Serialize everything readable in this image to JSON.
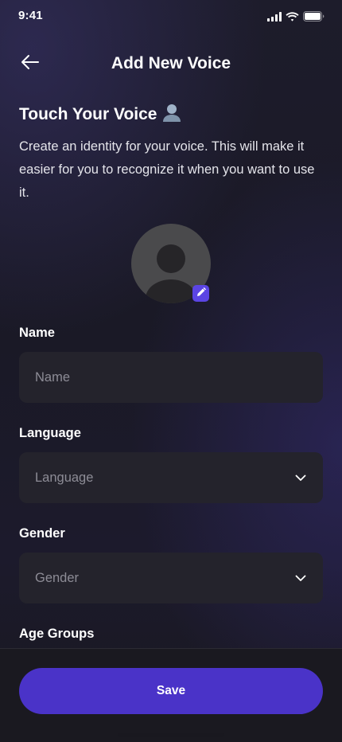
{
  "status_bar": {
    "time": "9:41",
    "signal_icon": "cellular-signal-icon",
    "wifi_icon": "wifi-icon",
    "battery_icon": "battery-icon"
  },
  "header": {
    "title": "Add New Voice",
    "back_icon": "arrow-left-icon"
  },
  "intro": {
    "title": "Touch Your Voice",
    "title_icon": "person-silhouette-icon",
    "description": "Create an identity for your voice. This will make it easier for you to recognize it when you want to use it."
  },
  "avatar": {
    "icon": "default-avatar-icon",
    "edit_icon": "pencil-icon"
  },
  "form": {
    "name": {
      "label": "Name",
      "placeholder": "Name",
      "value": ""
    },
    "language": {
      "label": "Language",
      "placeholder": "Language",
      "chevron_icon": "chevron-down-icon"
    },
    "gender": {
      "label": "Gender",
      "placeholder": "Gender",
      "chevron_icon": "chevron-down-icon"
    },
    "age_groups": {
      "label": "Age Groups"
    }
  },
  "actions": {
    "save_label": "Save"
  },
  "colors": {
    "accent": "#4a33c8",
    "edit_badge": "#5b45e4",
    "field_background": "#24232c",
    "placeholder": "#8d8c96",
    "background": "#1a1926"
  }
}
